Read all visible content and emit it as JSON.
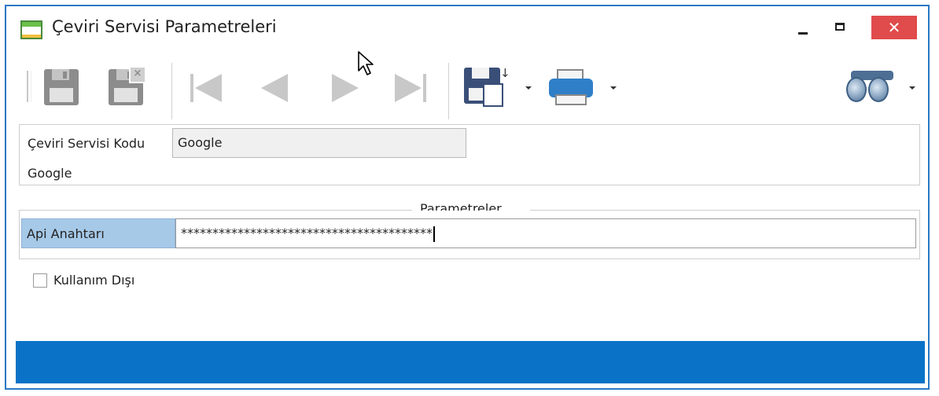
{
  "window": {
    "title": "Çeviri Servisi Parametreleri",
    "close_glyph": "✕",
    "border_color": "#2a79c4"
  },
  "toolbar": {
    "icons": [
      "save-icon",
      "cancel-save-icon",
      "first-record-icon",
      "previous-record-icon",
      "next-record-icon",
      "last-record-icon",
      "export-icon",
      "print-icon",
      "find-icon"
    ]
  },
  "header_panel": {
    "code_label": "Çeviri Servisi Kodu",
    "code_value": "Google",
    "description": "Google"
  },
  "parameters": {
    "group_title": "Parametreler",
    "api_key_label": "Api Anahtarı",
    "api_key_value": "****************************************"
  },
  "options": {
    "disabled_label": "Kullanım Dışı",
    "disabled_checked": false
  },
  "colors": {
    "accent": "#0a73c7",
    "label_highlight": "#a6c9e8",
    "close_button": "#e04b4b"
  }
}
